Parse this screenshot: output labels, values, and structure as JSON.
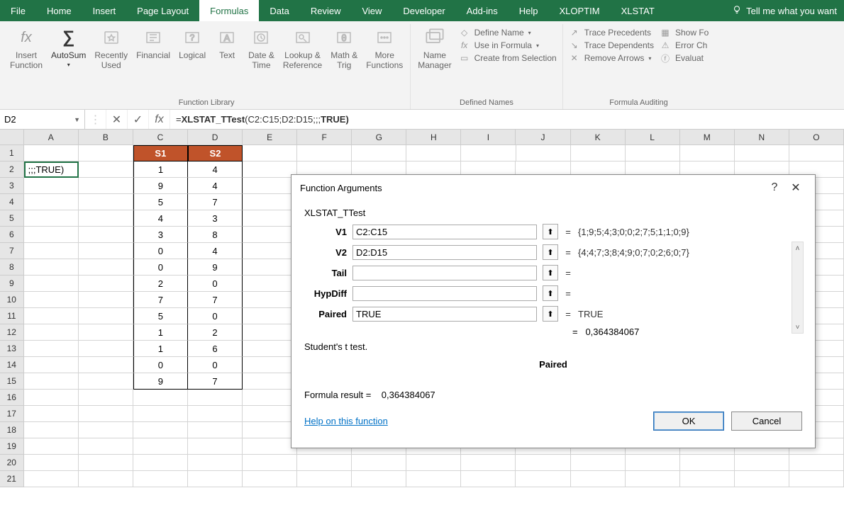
{
  "tabs": [
    "File",
    "Home",
    "Insert",
    "Page Layout",
    "Formulas",
    "Data",
    "Review",
    "View",
    "Developer",
    "Add-ins",
    "Help",
    "XLOPTIM",
    "XLSTAT"
  ],
  "active_tab": "Formulas",
  "tell_me": "Tell me what you want",
  "ribbon": {
    "fn_library_label": "Function Library",
    "defined_names_label": "Defined Names",
    "formula_auditing_label": "Formula Auditing",
    "insert_function": "Insert\nFunction",
    "autosum": "AutoSum",
    "recently_used": "Recently\nUsed",
    "financial": "Financial",
    "logical": "Logical",
    "text": "Text",
    "date_time": "Date &\nTime",
    "lookup_ref": "Lookup &\nReference",
    "math_trig": "Math &\nTrig",
    "more_functions": "More\nFunctions",
    "name_manager": "Name\nManager",
    "define_name": "Define Name",
    "use_in_formula": "Use in Formula",
    "create_from_selection": "Create from Selection",
    "trace_precedents": "Trace Precedents",
    "trace_dependents": "Trace Dependents",
    "remove_arrows": "Remove Arrows",
    "show_formulas": "Show Fo",
    "error_checking": "Error Ch",
    "evaluate": "Evaluat"
  },
  "name_box": "D2",
  "formula_bar": "=XLSTAT_TTest(C2:C15;D2:D15;;;TRUE)",
  "columns": [
    "A",
    "B",
    "C",
    "D",
    "E",
    "F",
    "G",
    "H",
    "I",
    "J",
    "K",
    "L",
    "M",
    "N",
    "O"
  ],
  "sheet": {
    "a2": ";;;TRUE)",
    "c_header": "S1",
    "d_header": "S2",
    "c_values": [
      1,
      9,
      5,
      4,
      3,
      0,
      0,
      2,
      7,
      5,
      1,
      1,
      0,
      9
    ],
    "d_values": [
      4,
      4,
      7,
      3,
      8,
      4,
      9,
      0,
      7,
      0,
      2,
      6,
      0,
      7
    ]
  },
  "dialog": {
    "title": "Function Arguments",
    "fn_name": "XLSTAT_TTest",
    "args": [
      {
        "label": "V1",
        "value": "C2:C15",
        "result": "{1;9;5;4;3;0;0;2;7;5;1;1;0;9}"
      },
      {
        "label": "V2",
        "value": "D2:D15",
        "result": "{4;4;7;3;8;4;9;0;7;0;2;6;0;7}"
      },
      {
        "label": "Tail",
        "value": "",
        "result": ""
      },
      {
        "label": "HypDiff",
        "value": "",
        "result": ""
      },
      {
        "label": "Paired",
        "value": "TRUE",
        "result": "TRUE"
      }
    ],
    "overall_result": "0,364384067",
    "description": "Student's t test.",
    "center_label": "Paired",
    "formula_result_label": "Formula result =",
    "formula_result_value": "0,364384067",
    "help_link": "Help on this function",
    "ok": "OK",
    "cancel": "Cancel"
  }
}
